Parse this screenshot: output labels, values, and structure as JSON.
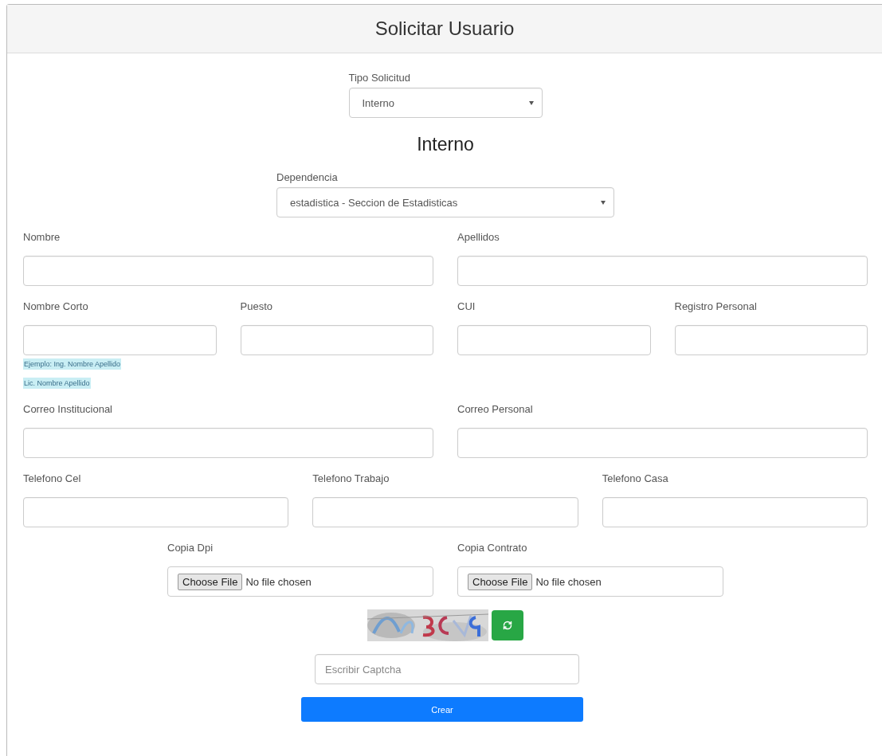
{
  "header": {
    "title": "Solicitar Usuario"
  },
  "request_type": {
    "label": "Tipo Solicitud",
    "value": "Interno"
  },
  "section_title": "Interno",
  "dependency": {
    "label": "Dependencia",
    "value": "estadistica - Seccion de Estadisticas"
  },
  "field_rows": [
    {
      "fields": [
        {
          "label": "Nombre"
        },
        {
          "label": "Apellidos"
        }
      ]
    },
    {
      "fields": [
        {
          "label": "Nombre Corto",
          "hints": [
            "Ejemplo: Ing. Nombre Apellido",
            "Lic. Nombre Apellido"
          ]
        },
        {
          "label": "Puesto"
        },
        {
          "label": "CUI"
        },
        {
          "label": "Registro Personal"
        }
      ]
    },
    {
      "fields": [
        {
          "label": "Correo Institucional"
        },
        {
          "label": "Correo Personal"
        }
      ]
    },
    {
      "fields": [
        {
          "label": "Telefono Cel"
        },
        {
          "label": "Telefono Trabajo"
        },
        {
          "label": "Telefono Casa"
        }
      ]
    }
  ],
  "file_uploads": [
    {
      "label": "Copia Dpi",
      "button": "Choose File",
      "status": "No file chosen"
    },
    {
      "label": "Copia Contrato",
      "button": "Choose File",
      "status": "No file chosen"
    }
  ],
  "captcha": {
    "placeholder": "Escribir Captcha"
  },
  "submit": {
    "label": "Crear"
  }
}
